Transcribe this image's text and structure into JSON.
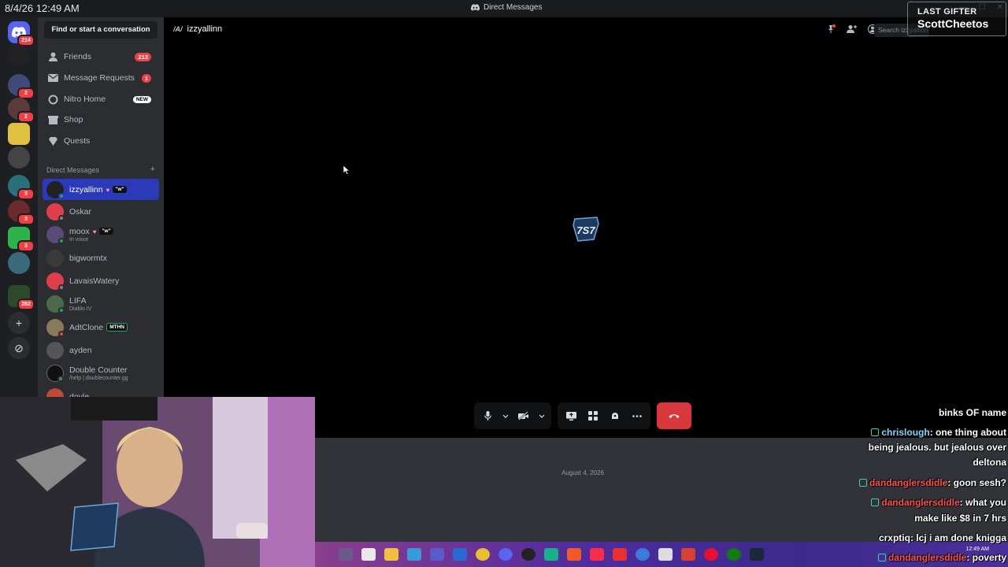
{
  "titlebar": {
    "datetime": "8/4/26 12:49 AM",
    "title": "Direct Messages"
  },
  "overlay_gifter": {
    "label": "LAST GIFTER",
    "name": "ScottCheetos"
  },
  "server_rail": {
    "dm_badge": "214",
    "badges": [
      "2",
      "2",
      "3",
      "3",
      "3",
      "282"
    ]
  },
  "sidebar": {
    "find_button": "Find or start a conversation",
    "nav": [
      {
        "label": "Friends",
        "count": "213"
      },
      {
        "label": "Message Requests",
        "count": "1"
      },
      {
        "label": "Nitro Home",
        "badge": "NEW"
      },
      {
        "label": "Shop"
      },
      {
        "label": "Quests"
      }
    ],
    "dm_header": "Direct Messages",
    "dms": [
      {
        "name": "izzyallinn",
        "tag": "\"w\"",
        "selected": true
      },
      {
        "name": "Oskar"
      },
      {
        "name": "moox",
        "tag": "\"w\"",
        "sub": "In voice"
      },
      {
        "name": "bigwormtx"
      },
      {
        "name": "LavaisWatery"
      },
      {
        "name": "LIFA",
        "sub": "Diablo IV"
      },
      {
        "name": "AdtClone",
        "tag": "MTHN"
      },
      {
        "name": "ayden"
      },
      {
        "name": "Double Counter",
        "sub": "/help | doublecounter.gg"
      },
      {
        "name": "doyle"
      }
    ]
  },
  "main": {
    "channel_name": "izzyallinn",
    "search_placeholder": "Search izzyallinn",
    "date_separator": "August 4, 2026"
  },
  "taskbar": {
    "clock": "12:49 AM"
  },
  "twitch_chat": [
    {
      "user": "",
      "text": "binks OF name"
    },
    {
      "user": "chrislough",
      "text": ": one thing about"
    },
    {
      "user": "",
      "text": "being jealous. but jealous over"
    },
    {
      "user": "",
      "text": "deltona"
    },
    {
      "user": "dandanglersdidle",
      "text": ": goon sesh?"
    },
    {
      "user": "dandanglersdidle",
      "text": ": what you"
    },
    {
      "user": "",
      "text": "make like $8 in 7 hrs"
    },
    {
      "user": "crxptiq",
      "text": ": lcj i am done knigga"
    },
    {
      "user": "dandanglersdidle",
      "text": ": poverty"
    }
  ],
  "colors": {
    "accent": "#5865f2",
    "selected_dm": "#2b3ab8",
    "end_call": "#da373c",
    "badge_red": "#f23f43"
  }
}
